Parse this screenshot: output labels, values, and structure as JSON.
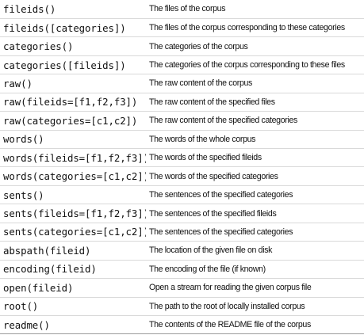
{
  "rows": [
    {
      "method": "fileids()",
      "description": "The files of the corpus"
    },
    {
      "method": "fileids([categories])",
      "description": "The files of the corpus corresponding to these categories"
    },
    {
      "method": "categories()",
      "description": "The categories of the corpus"
    },
    {
      "method": "categories([fileids])",
      "description": "The categories of the corpus corresponding to these files"
    },
    {
      "method": "raw()",
      "description": "The raw content of the corpus"
    },
    {
      "method": "raw(fileids=[f1,f2,f3])",
      "description": "The raw content of the specified files"
    },
    {
      "method": "raw(categories=[c1,c2])",
      "description": "The raw content of the specified categories"
    },
    {
      "method": "words()",
      "description": "The words of the whole corpus"
    },
    {
      "method": "words(fileids=[f1,f2,f3])",
      "description": "The words of the specified fileids"
    },
    {
      "method": "words(categories=[c1,c2])",
      "description": "The words of the specified categories"
    },
    {
      "method": "sents()",
      "description": "The sentences of the specified categories"
    },
    {
      "method": "sents(fileids=[f1,f2,f3])",
      "description": "The sentences of the specified fileids"
    },
    {
      "method": "sents(categories=[c1,c2])",
      "description": "The sentences of the specified categories"
    },
    {
      "method": "abspath(fileid)",
      "description": "The location of the given file on disk"
    },
    {
      "method": "encoding(fileid)",
      "description": "The encoding of the file (if known)"
    },
    {
      "method": "open(fileid)",
      "description": "Open a stream for reading the given corpus file"
    },
    {
      "method": "root()",
      "description": "The path to the root of locally installed corpus"
    },
    {
      "method": "readme()",
      "description": "The contents of the README file of the corpus"
    }
  ]
}
